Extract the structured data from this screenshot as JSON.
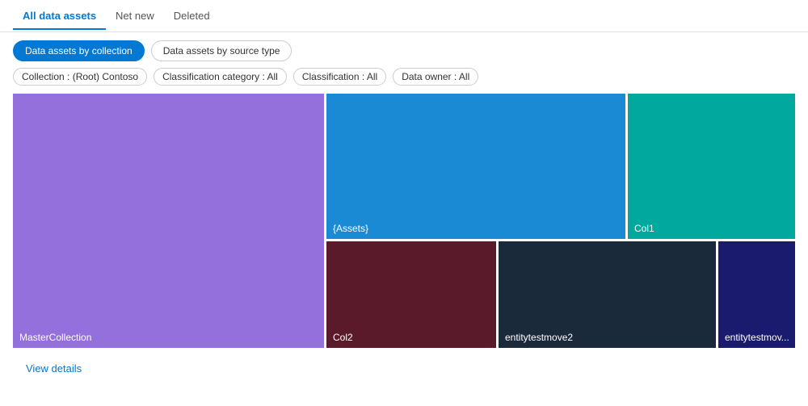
{
  "tabs": [
    {
      "id": "all-data-assets",
      "label": "All data assets",
      "active": true
    },
    {
      "id": "net-new",
      "label": "Net new",
      "active": false
    },
    {
      "id": "deleted",
      "label": "Deleted",
      "active": false
    }
  ],
  "view_toggles": [
    {
      "id": "by-collection",
      "label": "Data assets by collection",
      "active": true
    },
    {
      "id": "by-source-type",
      "label": "Data assets by source type",
      "active": false
    }
  ],
  "filters": [
    {
      "id": "collection",
      "label": "Collection : (Root) Contoso"
    },
    {
      "id": "classification-category",
      "label": "Classification category : All"
    },
    {
      "id": "classification",
      "label": "Classification : All"
    },
    {
      "id": "data-owner",
      "label": "Data owner : All"
    }
  ],
  "treemap": {
    "blocks": [
      {
        "id": "master",
        "label": "MasterCollection",
        "color": "#9370db"
      },
      {
        "id": "assets",
        "label": "{Assets}",
        "color": "#1a8ad4"
      },
      {
        "id": "col1",
        "label": "Col1",
        "color": "#00a89d"
      },
      {
        "id": "col2",
        "label": "Col2",
        "color": "#5a1a2a"
      },
      {
        "id": "entitytestmove2",
        "label": "entitytestmove2",
        "color": "#1a2a3a"
      },
      {
        "id": "entitytestmov",
        "label": "entitytestmov...",
        "color": "#1a1a6e"
      }
    ]
  },
  "footer": {
    "view_details_label": "View details"
  }
}
